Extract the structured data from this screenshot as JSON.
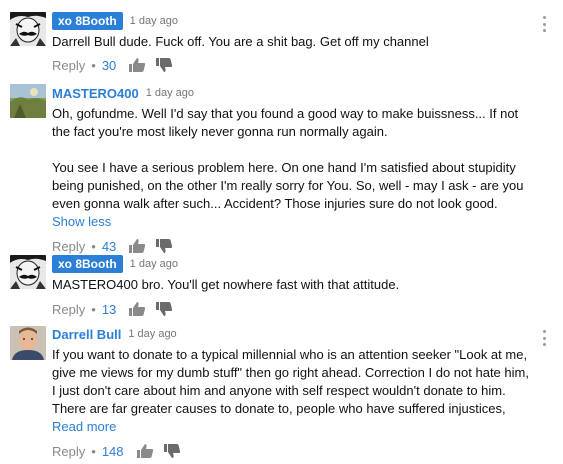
{
  "comments": [
    {
      "author": "xo 8Booth",
      "time": "1 day ago",
      "text": "Darrell Bull dude. Fuck off. You are a shit bag. Get off my channel",
      "reply_label": "Reply",
      "likes": "30",
      "avatar_icon": "mustache-face-avatar",
      "author_style": "badge"
    },
    {
      "author": "MASTERO400",
      "time": "1 day ago",
      "text": "Oh, gofundme. Well I'd say that you found a good way to make buissness... If not\nthe fact you're most likely never gonna run normally again.\n\nYou see I have a serious problem here. On one hand I'm satisfied about stupidity\nbeing punished, on the other I'm really sorry for You. So, well - may I ask - are you\neven gonna walk after such... Accident? Those injuries sure do not look good.",
      "toggle_label": "Show less",
      "reply_label": "Reply",
      "likes": "43",
      "avatar_icon": "landscape-photo-avatar",
      "author_style": "link"
    },
    {
      "author": "xo 8Booth",
      "time": "1 day ago",
      "text": "MASTERO400 bro. You'll get nowhere fast with that attitude.",
      "reply_label": "Reply",
      "likes": "13",
      "avatar_icon": "mustache-face-avatar",
      "author_style": "badge"
    },
    {
      "author": "Darrell Bull",
      "time": "1 day ago",
      "text": "If you want to donate to a typical millennial who is an attention seeker \"Look at me,\ngive me views for my dumb stuff\" then go right ahead. Correction I do not hate him,\nI just don't care about him and anyone with self respect wouldn't donate to him.\nThere are far greater causes to donate to, people who have suffered injustices,",
      "toggle_label": "Read more",
      "reply_label": "Reply",
      "likes": "148",
      "avatar_icon": "person-photo-avatar",
      "author_style": "link"
    }
  ],
  "colors": {
    "link_blue": "#2c7fd6",
    "meta_gray": "#767676",
    "icon_gray": "#8a8a8a"
  }
}
